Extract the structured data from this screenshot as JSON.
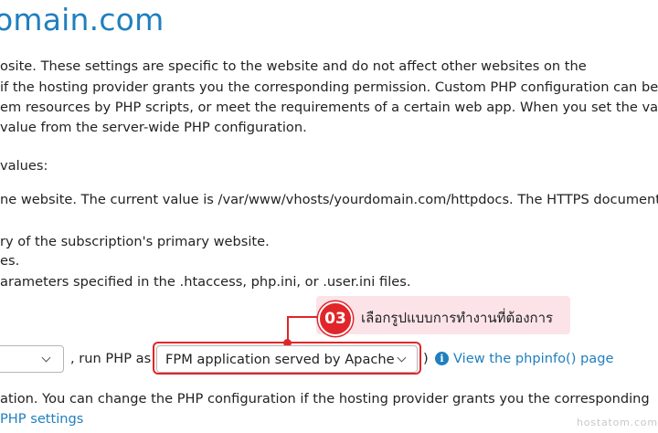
{
  "page": {
    "title": "omain.com",
    "description_lines": [
      "osite. These settings are specific to the website and do not affect other websites on the",
      "if the hosting provider grants you the corresponding permission. Custom PHP configuration can be",
      "em resources by PHP scripts, or meet the requirements of a certain web app. When you set the value",
      " value from the server-wide PHP configuration."
    ],
    "values_heading": " values:",
    "values_lines": [
      "ne website. The current value is /var/www/vhosts/yourdomain.com/httpdocs. The HTTPS document",
      "ry of the subscription's primary website.",
      "es.",
      "arameters specified in the .htaccess, php.ini, or .user.ini files."
    ]
  },
  "php_row": {
    "version_select_value": "",
    "run_php_as_label": ", run PHP as",
    "handler_select_value": "FPM application served by Apache",
    "close_paren": ")",
    "phpinfo_link": "View the phpinfo() page"
  },
  "footer": {
    "line1": "ation. You can change the PHP configuration if the hosting provider grants you the corresponding",
    "php_settings_link": "PHP settings"
  },
  "callout": {
    "step_number": "03",
    "text": "เลือกรูปแบบการทำงานที่ต้องการ"
  },
  "watermark": "hostatom.com",
  "colors": {
    "link": "#1f7fbf",
    "highlight": "#e0262a",
    "callout_bg": "#fbe3e8"
  },
  "icons": {
    "info": "info-circle-icon",
    "dropdown": "chevron-down-icon"
  }
}
